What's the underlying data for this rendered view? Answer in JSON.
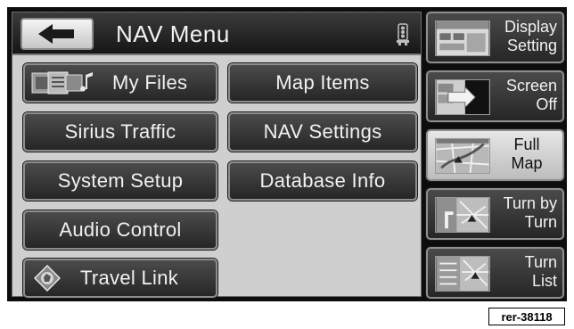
{
  "header": {
    "title": "NAV Menu",
    "back_icon": "left-arrow-icon",
    "status_icon": "traffic-signal-icon"
  },
  "menu": {
    "my_files": "My Files",
    "map_items": "Map Items",
    "sirius_traffic": "Sirius Traffic",
    "nav_settings": "NAV Settings",
    "system_setup": "System Setup",
    "database_info": "Database Info",
    "audio_control": "Audio Control",
    "travel_link": "Travel Link"
  },
  "side": {
    "display_setting": "Display\nSetting",
    "screen_off": "Screen\nOff",
    "full_map": "Full\nMap",
    "turn_by_turn": "Turn by\nTurn",
    "turn_list": "Turn\nList"
  },
  "reference": "rer-38118",
  "colors": {
    "button_dark": "#333333",
    "panel_bg": "#cfcfcf",
    "active_button": "#d8d8d8"
  }
}
